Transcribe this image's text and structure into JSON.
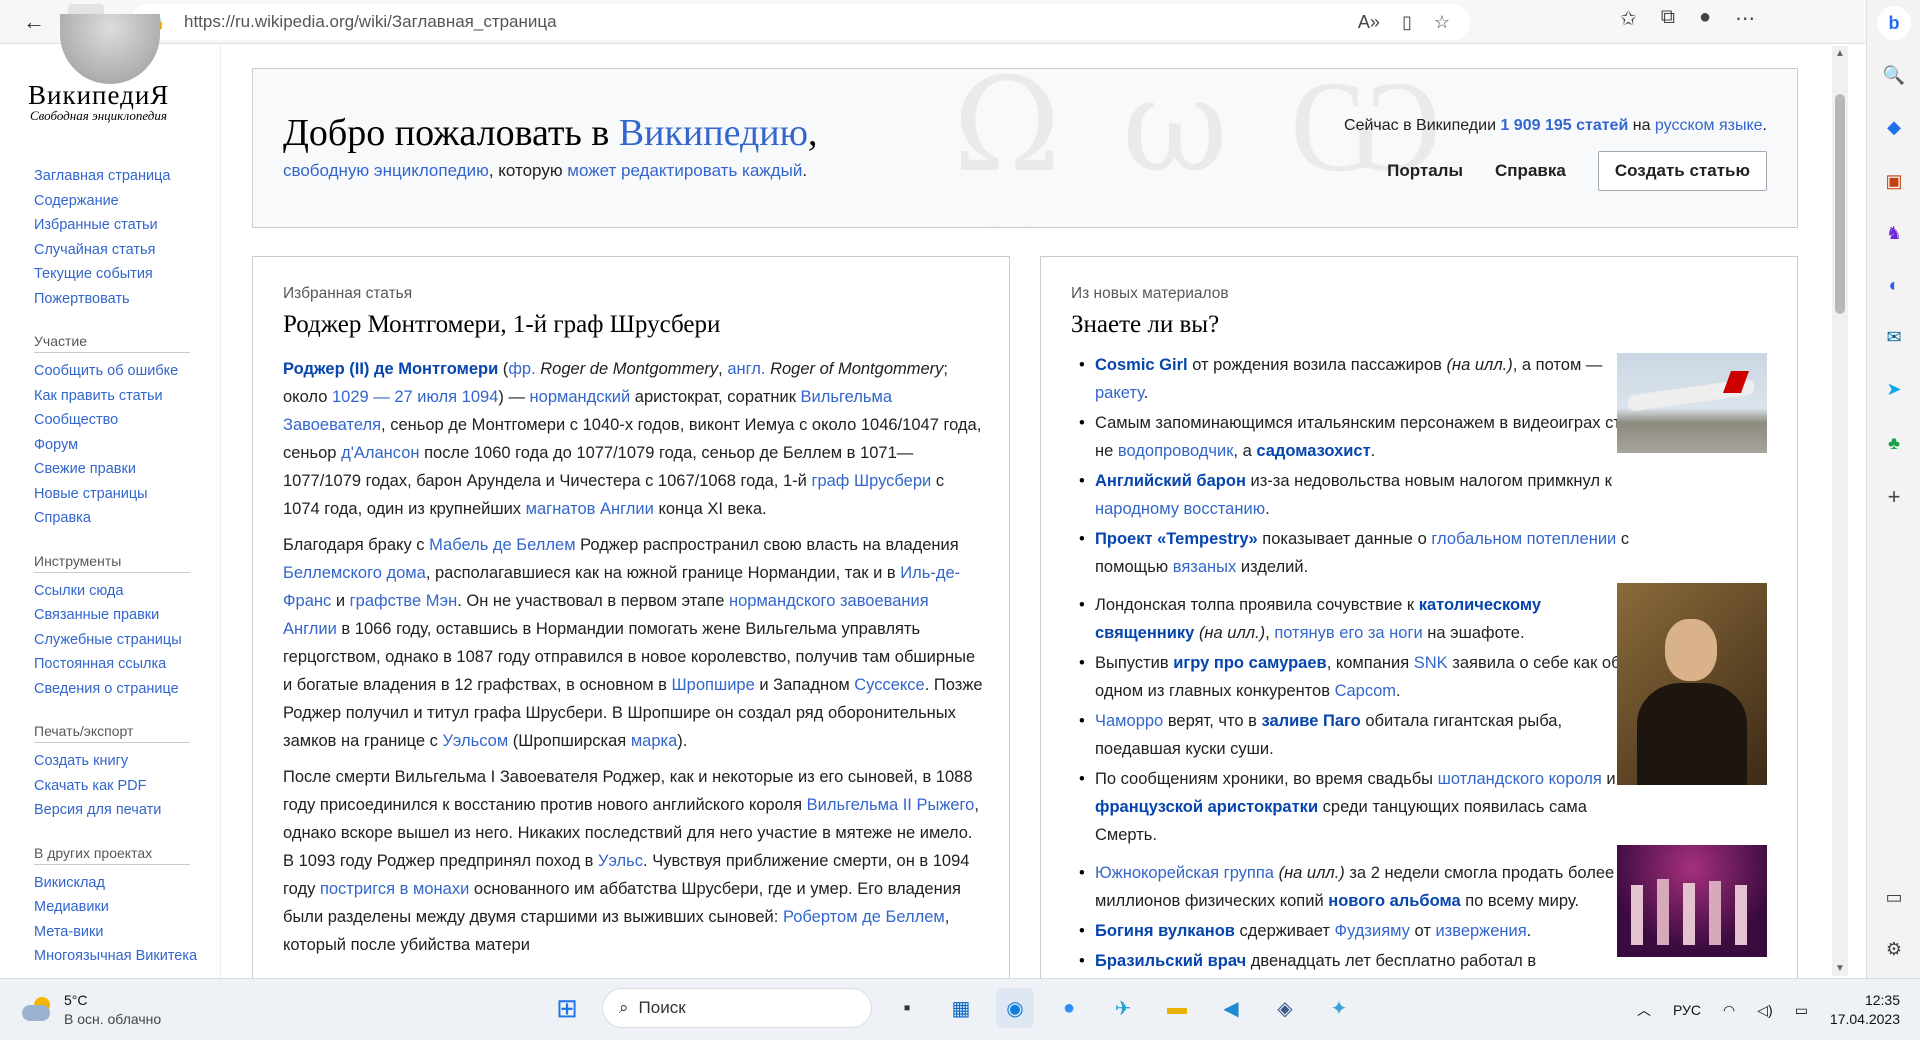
{
  "browser": {
    "url": "https://ru.wikipedia.org/wiki/Заглавная_страница"
  },
  "wiki": {
    "logo_title": "ВикипедиЯ",
    "logo_subtitle": "Свободная энциклопедия",
    "nav_main": [
      "Заглавная страница",
      "Содержание",
      "Избранные статьи",
      "Случайная статья",
      "Текущие события",
      "Пожертвовать"
    ],
    "nav_participation_heading": "Участие",
    "nav_participation": [
      "Сообщить об ошибке",
      "Как править статьи",
      "Сообщество",
      "Форум",
      "Свежие правки",
      "Новые страницы",
      "Справка"
    ],
    "nav_tools_heading": "Инструменты",
    "nav_tools": [
      "Ссылки сюда",
      "Связанные правки",
      "Служебные страницы",
      "Постоянная ссылка",
      "Сведения о странице"
    ],
    "nav_print_heading": "Печать/экспорт",
    "nav_print": [
      "Создать книгу",
      "Скачать как PDF",
      "Версия для печати"
    ],
    "nav_projects_heading": "В других проектах",
    "nav_projects": [
      "Викисклад",
      "Медиавики",
      "Мета-вики",
      "Многоязычная Викитека"
    ]
  },
  "welcome": {
    "title_prefix": "Добро пожаловать в ",
    "title_link": "Википедию",
    "title_suffix": ",",
    "sub_link1": "свободную энциклопедию",
    "sub_mid": ", которую ",
    "sub_link2": "может редактировать каждый",
    "sub_end": ".",
    "count_prefix": "Сейчас в Википедии ",
    "count_value": "1 909 195 статей",
    "count_mid": " на ",
    "count_lang": "русском языке",
    "count_end": ".",
    "portals": "Порталы",
    "help": "Справка",
    "create": "Создать статью"
  },
  "featured": {
    "kicker": "Избранная статья",
    "title": "Роджер Монтгомери, 1-й граф Шрусбери"
  },
  "dyk": {
    "kicker": "Из новых материалов",
    "title": "Знаете ли вы?"
  },
  "taskbar": {
    "temp": "5°C",
    "weather": "В осн. облачно",
    "search": "Поиск",
    "lang": "РУС",
    "time": "12:35",
    "date": "17.04.2023"
  }
}
